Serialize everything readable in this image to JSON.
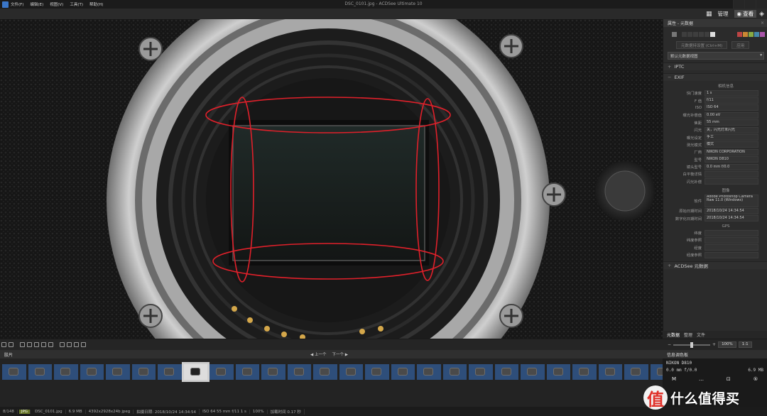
{
  "window": {
    "title": "DSC_0101.jpg - ACDSee Ultimate 10",
    "menu": [
      "文件(F)",
      "编辑(E)",
      "视图(V)",
      "工具(T)",
      "帮助(H)"
    ]
  },
  "modes": {
    "manage": "管理",
    "view": "查看"
  },
  "panel": {
    "title": "属性 - 元数据",
    "close": "×",
    "btn_save": "元数据持设置 (Ctrl+M)",
    "btn_apply": "应用",
    "view_select": "默认元数据视图",
    "iptc_label": "IPTC",
    "exif_label": "EXIF",
    "acdsee_label": "ACDSee 元数据",
    "camera_group": "相机信息",
    "image_group": "图像",
    "gps_group": "GPS",
    "exif_rows": [
      {
        "k": "快门速度",
        "v": "1 s"
      },
      {
        "k": "F 值",
        "v": "f/11"
      },
      {
        "k": "ISO",
        "v": "ISO 64"
      },
      {
        "k": "曝光补偿值",
        "v": "0.00 eV"
      },
      {
        "k": "焦距",
        "v": "55 mm"
      },
      {
        "k": "闪光",
        "v": "关，闪光灯未闪光"
      },
      {
        "k": "曝光设定",
        "v": "手工"
      },
      {
        "k": "测光模式",
        "v": "模式"
      },
      {
        "k": "厂商",
        "v": "NIKON CORPORATION"
      },
      {
        "k": "型号",
        "v": "NIKON D810"
      },
      {
        "k": "镜头型号",
        "v": "0.0 mm f/0.0"
      },
      {
        "k": "白平衡详情",
        "v": ""
      },
      {
        "k": "闪光补偿",
        "v": ""
      }
    ],
    "image_rows": [
      {
        "k": "软件",
        "v": "Adobe Photoshop Camera Raw 11.0 (Windows)",
        "tall": true
      },
      {
        "k": "原始日期时间",
        "v": "2018/10/24 14:34:54"
      },
      {
        "k": "数字化日期时间",
        "v": "2018/10/24 14:34:54"
      }
    ],
    "gps_rows": [
      {
        "k": "纬度",
        "v": ""
      },
      {
        "k": "纬度参照",
        "v": ""
      },
      {
        "k": "经度",
        "v": ""
      },
      {
        "k": "经度参照",
        "v": ""
      }
    ],
    "tabs": [
      "元数据",
      "整理",
      "文件"
    ]
  },
  "toolbar": {
    "zoom": "100%",
    "ratio": "1:1"
  },
  "filmstrip": {
    "label": "胶片",
    "prev": "◀ 上一个",
    "next": "下一个 ▶",
    "count": 26,
    "selected_index": 7
  },
  "histogram": {
    "label": "信息调色板",
    "model": "NIKON D810",
    "lens": "0.0 mm f/0.0",
    "aperture": "6.9 MB",
    "modes": [
      "M",
      "…",
      "⊡",
      "⑤"
    ]
  },
  "status": {
    "index": "8/148",
    "format": "JPG",
    "filename": "DSC_0101.jpg",
    "size": "6.9 MB",
    "dims": "4392x2928x24b jpeg",
    "date": "拍摄日期: 2018/10/24 14:34:54",
    "exposure": "ISO 64   55 mm   f/11   1 s",
    "zoom": "100%",
    "load": "加载时间 0.17 秒"
  },
  "watermark": {
    "badge": "值",
    "text": "什么值得买"
  },
  "colors": {
    "accent": "#4a4a4a",
    "annotation": "#e0202a",
    "jpg_badge": "#6b7a2a"
  }
}
